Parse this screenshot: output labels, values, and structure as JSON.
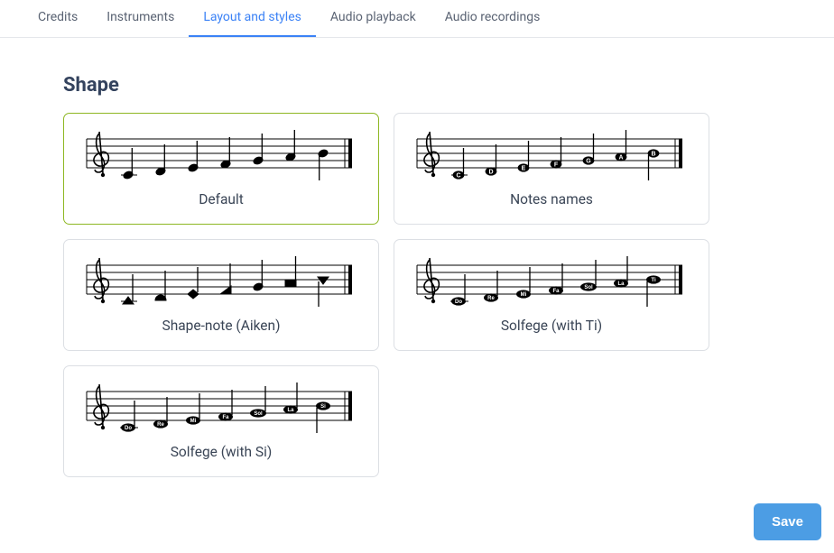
{
  "tabs": {
    "items": [
      {
        "label": "Credits",
        "active": false
      },
      {
        "label": "Instruments",
        "active": false
      },
      {
        "label": "Layout and styles",
        "active": true
      },
      {
        "label": "Audio playback",
        "active": false
      },
      {
        "label": "Audio recordings",
        "active": false
      }
    ]
  },
  "section": {
    "title": "Shape"
  },
  "options": [
    {
      "id": "default",
      "label": "Default",
      "selected": true,
      "style": "plain"
    },
    {
      "id": "notes-names",
      "label": "Notes names",
      "selected": false,
      "style": "letters",
      "letters": [
        "C",
        "D",
        "E",
        "F",
        "G",
        "A",
        "B"
      ]
    },
    {
      "id": "shape-note",
      "label": "Shape-note (Aiken)",
      "selected": false,
      "style": "shapes"
    },
    {
      "id": "solfege-ti",
      "label": "Solfege (with Ti)",
      "selected": false,
      "style": "solfege",
      "syllables": [
        "Do",
        "Re",
        "Mi",
        "Fa",
        "Sol",
        "La",
        "Ti"
      ]
    },
    {
      "id": "solfege-si",
      "label": "Solfege (with Si)",
      "selected": false,
      "style": "solfege",
      "syllables": [
        "Do",
        "Re",
        "Mi",
        "Fa",
        "Sol",
        "La",
        "Si"
      ]
    }
  ],
  "buttons": {
    "save": "Save"
  }
}
